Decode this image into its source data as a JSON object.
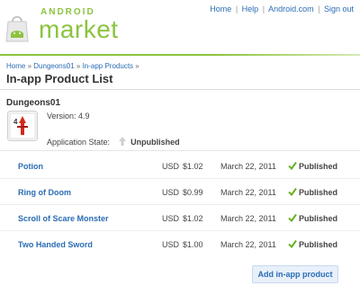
{
  "topnav": {
    "links": [
      "Home",
      "Help",
      "Android.com",
      "Sign out"
    ]
  },
  "logo": {
    "small_text": "ANDROID",
    "big_text": "market"
  },
  "breadcrumb": {
    "items": [
      "Home",
      "Dungeons01",
      "In-app Products"
    ],
    "separator": "»"
  },
  "page": {
    "title": "In-app Product List"
  },
  "app": {
    "name": "Dungeons01",
    "version_label": "Version:",
    "version": "4.9",
    "state_label": "Application State:",
    "state": "Unpublished",
    "icon_text": "4"
  },
  "products": [
    {
      "name": "Potion",
      "currency": "USD",
      "price": "$1.02",
      "date": "March 22, 2011",
      "status": "Published"
    },
    {
      "name": "Ring of Doom",
      "currency": "USD",
      "price": "$0.99",
      "date": "March 22, 2011",
      "status": "Published"
    },
    {
      "name": "Scroll of Scare Monster",
      "currency": "USD",
      "price": "$1.02",
      "date": "March 22, 2011",
      "status": "Published"
    },
    {
      "name": "Two Handed Sword",
      "currency": "USD",
      "price": "$1.00",
      "date": "March 22, 2011",
      "status": "Published"
    }
  ],
  "actions": {
    "add_label": "Add in-app product"
  },
  "colors": {
    "brand_green": "#8cc33f",
    "link_blue": "#2a6db5",
    "check_green": "#6ab023"
  }
}
